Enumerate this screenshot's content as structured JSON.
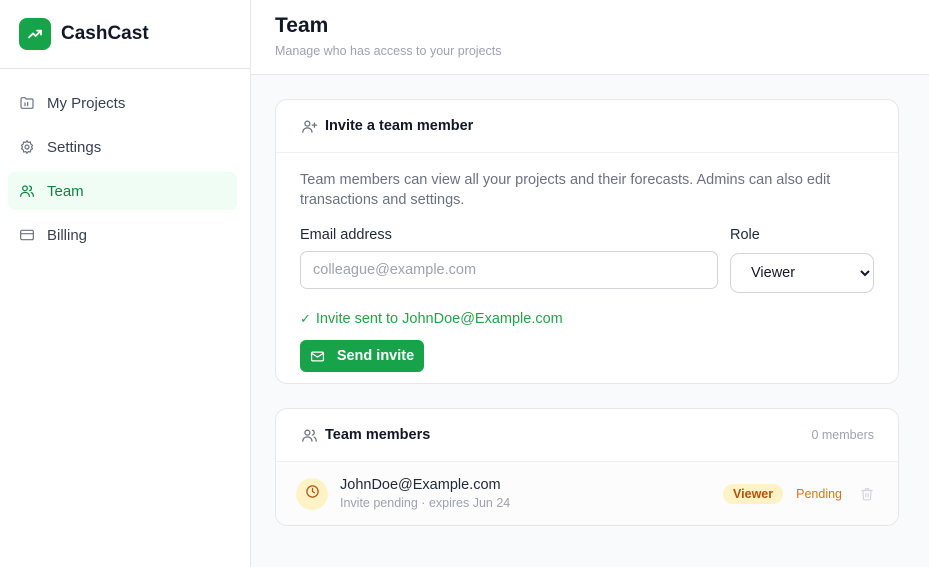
{
  "app": {
    "name": "CashCast",
    "logo_icon": "trending-up-icon",
    "brand_color": "#16a34a"
  },
  "sidebar": {
    "items": [
      {
        "label": "My Projects",
        "icon": "folder-icon",
        "active": false
      },
      {
        "label": "Settings",
        "icon": "gear-icon",
        "active": false
      },
      {
        "label": "Team",
        "icon": "users-icon",
        "active": true
      },
      {
        "label": "Billing",
        "icon": "credit-card-icon",
        "active": false
      }
    ]
  },
  "header": {
    "title": "Team",
    "subtitle": "Manage who has access to your projects"
  },
  "invite": {
    "title": "Invite a team member",
    "icon": "user-plus-icon",
    "description": "Team members can view all your projects and their forecasts. Admins can also edit transactions and settings.",
    "email_label": "Email address",
    "email_placeholder": "colleague@example.com",
    "email_value": "",
    "role_label": "Role",
    "role_value": "Viewer",
    "success_message": "Invite sent to JohnDoe@Example.com",
    "send_label": "Send invite",
    "send_icon": "mail-icon"
  },
  "members": {
    "title": "Team members",
    "icon": "users-icon",
    "count_label": "0 members",
    "rows": [
      {
        "email": "JohnDoe@Example.com",
        "meta": "Invite pending · expires Jun 24",
        "avatar_icon": "clock-icon",
        "role": "Viewer",
        "status": "Pending",
        "delete_icon": "trash-icon"
      }
    ]
  },
  "colors": {
    "accent": "#16a34a",
    "pending": "#d97706",
    "badge_bg": "#fef3c7",
    "success_text": "#22a34a"
  }
}
